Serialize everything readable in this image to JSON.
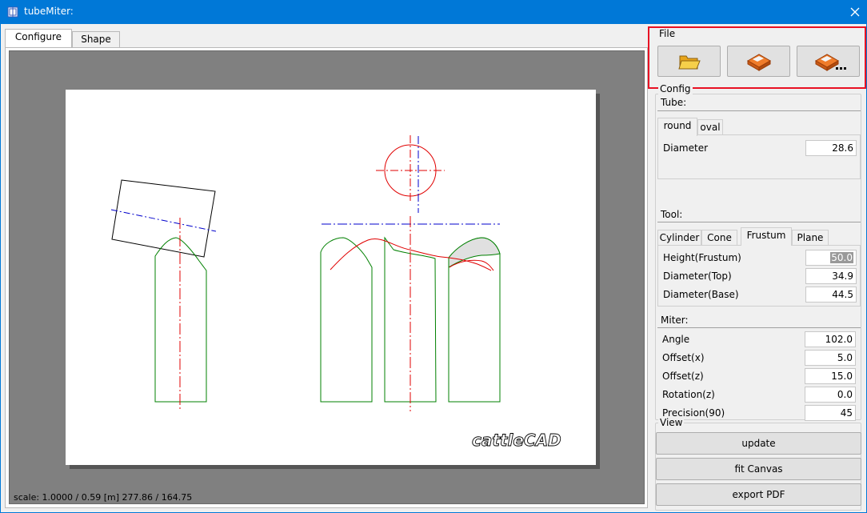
{
  "window": {
    "title": "tubeMiter:"
  },
  "left_tabs": [
    {
      "label": "Configure"
    },
    {
      "label": "Shape"
    }
  ],
  "status": {
    "text": "scale: 1.0000 / 0.59  [m]  277.86 / 164.75"
  },
  "drawing": {
    "logo_text": "cattleCAD"
  },
  "file_group": {
    "label": "File",
    "buttons": [
      {
        "icon": "folder-open-icon"
      },
      {
        "icon": "floppy-save-icon"
      },
      {
        "icon": "floppy-save-as-icon"
      }
    ]
  },
  "config": {
    "label": "Config",
    "tube": {
      "label": "Tube:",
      "tabs": [
        {
          "label": "round"
        },
        {
          "label": "oval"
        }
      ],
      "fields": [
        {
          "label": "Diameter",
          "value": "28.6"
        }
      ]
    },
    "tool": {
      "label": "Tool:",
      "tabs": [
        {
          "label": "Cylinder"
        },
        {
          "label": "Cone"
        },
        {
          "label": "Frustum"
        },
        {
          "label": "Plane"
        }
      ],
      "fields": [
        {
          "label": "Height(Frustum)",
          "value": "50.0"
        },
        {
          "label": "Diameter(Top)",
          "value": "34.9"
        },
        {
          "label": "Diameter(Base)",
          "value": "44.5"
        }
      ]
    },
    "miter": {
      "label": "Miter:",
      "fields": [
        {
          "label": "Angle",
          "value": "102.0"
        },
        {
          "label": "Offset(x)",
          "value": "5.0"
        },
        {
          "label": "Offset(z)",
          "value": "15.0"
        },
        {
          "label": "Rotation(z)",
          "value": "0.0"
        },
        {
          "label": "Precision(90)",
          "value": "45"
        }
      ]
    }
  },
  "view": {
    "label": "View",
    "buttons": [
      {
        "label": "update"
      },
      {
        "label": "fit Canvas"
      },
      {
        "label": "export PDF"
      }
    ]
  },
  "colors": {
    "titlebar": "#0078d7",
    "highlight": "#e81123",
    "outline_green": "#008000",
    "axis_red": "#e00000",
    "axis_blue": "#0000cc"
  }
}
